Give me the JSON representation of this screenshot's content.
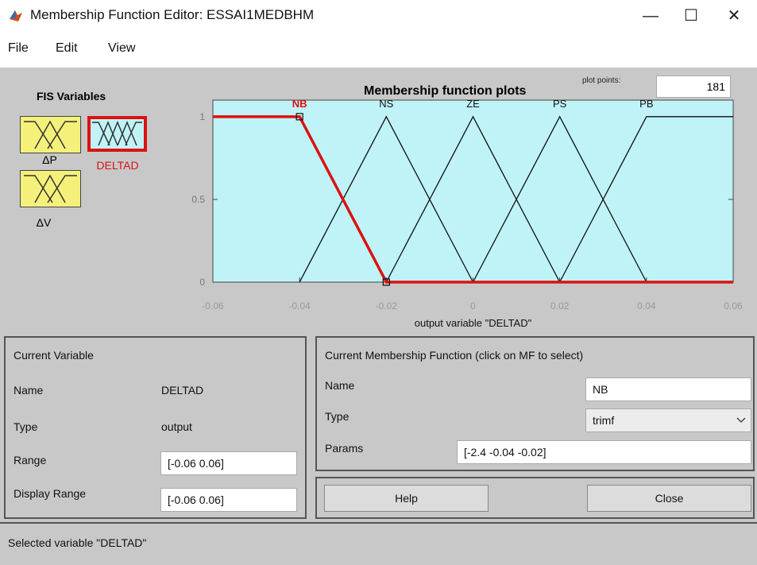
{
  "window": {
    "title": "Membership Function Editor: ESSAI1MEDBHM",
    "minimize_glyph": "—",
    "maximize_glyph": "☐",
    "close_glyph": "✕"
  },
  "menu": {
    "items": [
      "File",
      "Edit",
      "View"
    ]
  },
  "fis_variables": {
    "title": "FIS Variables",
    "items": [
      {
        "label": "ΔP",
        "selected": false
      },
      {
        "label": "DELTAD",
        "selected": true
      },
      {
        "label": "ΔV",
        "selected": false
      }
    ]
  },
  "plot": {
    "title": "Membership function plots",
    "plot_points_label": "plot points:",
    "plot_points_value": "181",
    "xlabel": "output variable \"DELTAD\""
  },
  "chart_data": {
    "type": "line",
    "title": "Membership function plots",
    "xlabel": "output variable \"DELTAD\"",
    "ylabel": "",
    "xlim": [
      -0.06,
      0.06
    ],
    "ylim": [
      0,
      1.1
    ],
    "x_ticks": [
      "-0.06",
      "-0.04",
      "-0.02",
      "0",
      "0.02",
      "0.04",
      "0.06"
    ],
    "y_ticks": [
      "0",
      "0.5",
      "1"
    ],
    "grid": false,
    "background_color": "#bff3f7",
    "selected_color": "#dd1111",
    "series": [
      {
        "name": "NB",
        "selected": true,
        "points": [
          [
            -0.06,
            1
          ],
          [
            -0.04,
            1
          ],
          [
            -0.02,
            0
          ],
          [
            0.06,
            0
          ]
        ]
      },
      {
        "name": "NS",
        "selected": false,
        "points": [
          [
            -0.04,
            0
          ],
          [
            -0.02,
            1
          ],
          [
            0,
            0
          ]
        ]
      },
      {
        "name": "ZE",
        "selected": false,
        "points": [
          [
            -0.02,
            0
          ],
          [
            0,
            1
          ],
          [
            0.02,
            0
          ]
        ]
      },
      {
        "name": "PS",
        "selected": false,
        "points": [
          [
            0,
            0
          ],
          [
            0.02,
            1
          ],
          [
            0.04,
            0
          ]
        ]
      },
      {
        "name": "PB",
        "selected": false,
        "points": [
          [
            0.04,
            1
          ],
          [
            0.06,
            1
          ]
        ],
        "rise": [
          [
            0.02,
            0
          ],
          [
            0.04,
            1
          ]
        ]
      }
    ]
  },
  "current_variable": {
    "title": "Current Variable",
    "name_label": "Name",
    "name_value": "DELTAD",
    "type_label": "Type",
    "type_value": "output",
    "range_label": "Range",
    "range_value": "[-0.06 0.06]",
    "display_range_label": "Display Range",
    "display_range_value": "[-0.06 0.06]"
  },
  "current_mf": {
    "title": "Current Membership Function (click on MF to select)",
    "name_label": "Name",
    "name_value": "NB",
    "type_label": "Type",
    "type_value": "trimf",
    "params_label": "Params",
    "params_value": "[-2.4 -0.04 -0.02]"
  },
  "buttons": {
    "help": "Help",
    "close": "Close"
  },
  "status": {
    "text": "Selected variable \"DELTAD\""
  }
}
